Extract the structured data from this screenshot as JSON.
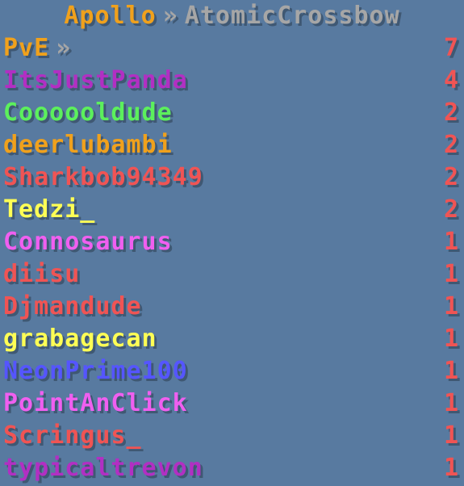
{
  "header": {
    "server": "Apollo",
    "separator": "»",
    "player": "AtomicCrossbow"
  },
  "category": {
    "name": "PvE",
    "separator": "»",
    "score": "7",
    "name_color": "#f0a11c",
    "score_color": "#f05454"
  },
  "score_color": "#f05454",
  "rows": [
    {
      "name": "ItsJustPanda",
      "score": "4",
      "color": "#b22fc3"
    },
    {
      "name": "Coooooldude",
      "score": "2",
      "color": "#5cf05c"
    },
    {
      "name": "deerlubambi",
      "score": "2",
      "color": "#f0a11c"
    },
    {
      "name": "Sharkbob94349",
      "score": "2",
      "color": "#f05454"
    },
    {
      "name": "Tedzi_",
      "score": "2",
      "color": "#ffff55"
    },
    {
      "name": "Connosaurus",
      "score": "1",
      "color": "#f05ff0"
    },
    {
      "name": "diisu",
      "score": "1",
      "color": "#f05454"
    },
    {
      "name": "Djmandude",
      "score": "1",
      "color": "#f05454"
    },
    {
      "name": "grabagecan",
      "score": "1",
      "color": "#ffff55"
    },
    {
      "name": "NeonPrime100",
      "score": "1",
      "color": "#5555ff"
    },
    {
      "name": "PointAnClick",
      "score": "1",
      "color": "#f05ff0"
    },
    {
      "name": "Scringus_",
      "score": "1",
      "color": "#f05454"
    },
    {
      "name": "typicaltrevon",
      "score": "1",
      "color": "#b22fc3"
    }
  ]
}
